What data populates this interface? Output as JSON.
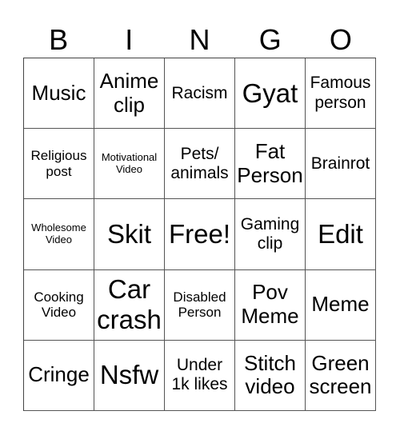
{
  "header": {
    "letters": [
      "B",
      "I",
      "N",
      "G",
      "O"
    ]
  },
  "board": {
    "rows": [
      [
        {
          "text": "Music",
          "size": "lg"
        },
        {
          "text": "Anime\nclip",
          "size": "lg"
        },
        {
          "text": "Racism",
          "size": "md"
        },
        {
          "text": "Gyat",
          "size": "xl"
        },
        {
          "text": "Famous\nperson",
          "size": "md"
        }
      ],
      [
        {
          "text": "Religious\npost",
          "size": "sm"
        },
        {
          "text": "Motivational\nVideo",
          "size": "xs"
        },
        {
          "text": "Pets/\nanimals",
          "size": "md"
        },
        {
          "text": "Fat\nPerson",
          "size": "lg"
        },
        {
          "text": "Brainrot",
          "size": "md"
        }
      ],
      [
        {
          "text": "Wholesome\nVideo",
          "size": "xs"
        },
        {
          "text": "Skit",
          "size": "xl"
        },
        {
          "text": "Free!",
          "size": "xl"
        },
        {
          "text": "Gaming\nclip",
          "size": "md"
        },
        {
          "text": "Edit",
          "size": "xl"
        }
      ],
      [
        {
          "text": "Cooking\nVideo",
          "size": "sm"
        },
        {
          "text": "Car\ncrash",
          "size": "xl"
        },
        {
          "text": "Disabled\nPerson",
          "size": "sm"
        },
        {
          "text": "Pov\nMeme",
          "size": "lg"
        },
        {
          "text": "Meme",
          "size": "lg"
        }
      ],
      [
        {
          "text": "Cringe",
          "size": "lg"
        },
        {
          "text": "Nsfw",
          "size": "xl"
        },
        {
          "text": "Under\n1k likes",
          "size": "md"
        },
        {
          "text": "Stitch\nvideo",
          "size": "lg"
        },
        {
          "text": "Green\nscreen",
          "size": "lg"
        }
      ]
    ]
  }
}
